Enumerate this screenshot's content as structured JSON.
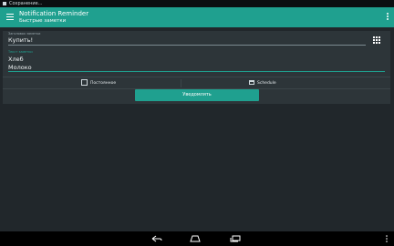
{
  "status_bar": {
    "notification_text": "Сохранение..."
  },
  "app_bar": {
    "title": "Notification Reminder",
    "subtitle": "Быстрые заметки",
    "menu_icon": "hamburger-menu-icon",
    "overflow_icon": "more-vert-icon"
  },
  "note": {
    "title_label": "Заголовок заметки",
    "title_value": "Купить!",
    "body_label": "Текст заметки",
    "body_lines": [
      "Хлеб",
      "Молоко"
    ],
    "templates_icon": "grid-icon"
  },
  "options": {
    "persistent_label": "Постоянное",
    "persistent_checked": false,
    "schedule_label": "Schedule",
    "schedule_icon": "calendar-icon"
  },
  "actions": {
    "notify_label": "Уведомлять"
  },
  "colors": {
    "accent": "#1fa08f",
    "background": "#21272b",
    "card": "#2d3539"
  },
  "nav_bar": {
    "back_icon": "back-icon",
    "home_icon": "home-icon",
    "recents_icon": "recents-icon",
    "more_icon": "more-vert-icon"
  }
}
